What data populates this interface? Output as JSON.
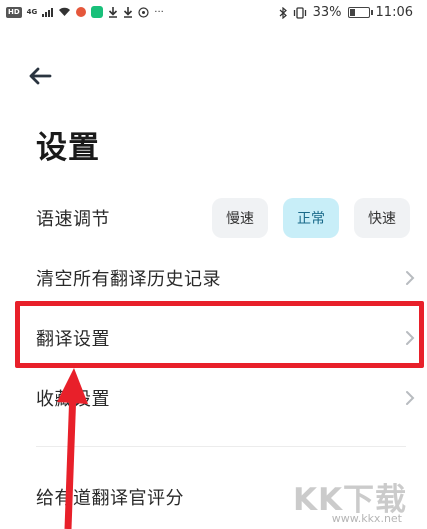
{
  "status_bar": {
    "hd": "HD",
    "network": "4G",
    "battery_percent": "33%",
    "battery_level": 0.33,
    "time": "11:06"
  },
  "header": {
    "title": "设置"
  },
  "speech_speed": {
    "label": "语速调节",
    "options": [
      "慢速",
      "正常",
      "快速"
    ],
    "selected": "正常"
  },
  "rows": [
    {
      "label": "清空所有翻译历史记录"
    },
    {
      "label": "翻译设置"
    },
    {
      "label": "收藏设置"
    },
    {
      "label": "给有道翻译官评分"
    }
  ],
  "watermark": {
    "logo": "KK下载",
    "url": "www.kkx.net"
  },
  "colors": {
    "accent_bg": "#c8eef8",
    "accent_text": "#1a6a8a",
    "highlight": "#e8202a"
  }
}
